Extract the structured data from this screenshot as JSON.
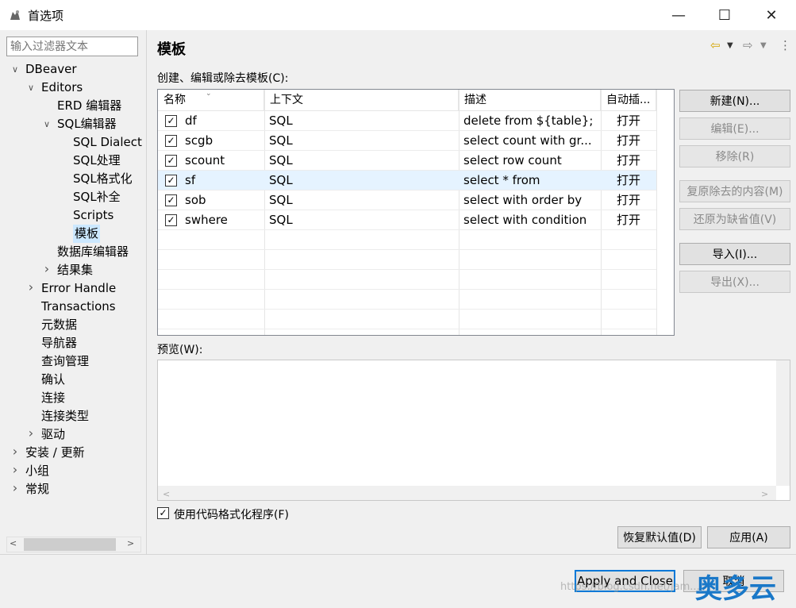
{
  "window": {
    "title": "首选项"
  },
  "filter": {
    "placeholder": "输入过滤器文本"
  },
  "tree": [
    {
      "label": "DBeaver",
      "level": 0,
      "twisty": "open"
    },
    {
      "label": "Editors",
      "level": 1,
      "twisty": "open"
    },
    {
      "label": "ERD 编辑器",
      "level": 2,
      "twisty": ""
    },
    {
      "label": "SQL编辑器",
      "level": 2,
      "twisty": "open"
    },
    {
      "label": "SQL Dialect",
      "level": 3,
      "twisty": ""
    },
    {
      "label": "SQL处理",
      "level": 3,
      "twisty": ""
    },
    {
      "label": "SQL格式化",
      "level": 3,
      "twisty": ""
    },
    {
      "label": "SQL补全",
      "level": 3,
      "twisty": ""
    },
    {
      "label": "Scripts",
      "level": 3,
      "twisty": ""
    },
    {
      "label": "模板",
      "level": 3,
      "twisty": "",
      "selected": true
    },
    {
      "label": "数据库编辑器",
      "level": 2,
      "twisty": ""
    },
    {
      "label": "结果集",
      "level": 2,
      "twisty": "closed"
    },
    {
      "label": "Error Handle",
      "level": 1,
      "twisty": "closed"
    },
    {
      "label": "Transactions",
      "level": 1,
      "twisty": ""
    },
    {
      "label": "元数据",
      "level": 1,
      "twisty": ""
    },
    {
      "label": "导航器",
      "level": 1,
      "twisty": ""
    },
    {
      "label": "查询管理",
      "level": 1,
      "twisty": ""
    },
    {
      "label": "确认",
      "level": 1,
      "twisty": ""
    },
    {
      "label": "连接",
      "level": 1,
      "twisty": ""
    },
    {
      "label": "连接类型",
      "level": 1,
      "twisty": ""
    },
    {
      "label": "驱动",
      "level": 1,
      "twisty": "closed"
    },
    {
      "label": "安装 / 更新",
      "level": 0,
      "twisty": "closed"
    },
    {
      "label": "小组",
      "level": 0,
      "twisty": "closed"
    },
    {
      "label": "常规",
      "level": 0,
      "twisty": "closed"
    }
  ],
  "page": {
    "title": "模板",
    "table_label": "创建、编辑或除去模板(C):",
    "columns": [
      "名称",
      "上下文",
      "描述",
      "自动插..."
    ],
    "rows": [
      {
        "name": "df",
        "context": "SQL",
        "desc": "delete from ${table};",
        "auto": "打开"
      },
      {
        "name": "scgb",
        "context": "SQL",
        "desc": "select count with gr...",
        "auto": "打开"
      },
      {
        "name": "scount",
        "context": "SQL",
        "desc": "select row count",
        "auto": "打开"
      },
      {
        "name": "sf",
        "context": "SQL",
        "desc": "select * from",
        "auto": "打开"
      },
      {
        "name": "sob",
        "context": "SQL",
        "desc": "select with order by",
        "auto": "打开"
      },
      {
        "name": "swhere",
        "context": "SQL",
        "desc": "select with condition",
        "auto": "打开"
      }
    ],
    "buttons": {
      "new": "新建(N)...",
      "edit": "编辑(E)...",
      "remove": "移除(R)",
      "restore_removed": "复原除去的内容(M)",
      "revert_default": "还原为缺省值(V)",
      "import": "导入(I)...",
      "export": "导出(X)..."
    },
    "preview_label": "预览(W):",
    "use_formatter": "使用代码格式化程序(F)",
    "restore_defaults": "恢复默认值(D)",
    "apply": "应用(A)"
  },
  "footer": {
    "apply_close": "Apply and Close",
    "cancel": "取消"
  },
  "watermark": "https://blog.csdn.net/jam...",
  "logo": "奥多云"
}
